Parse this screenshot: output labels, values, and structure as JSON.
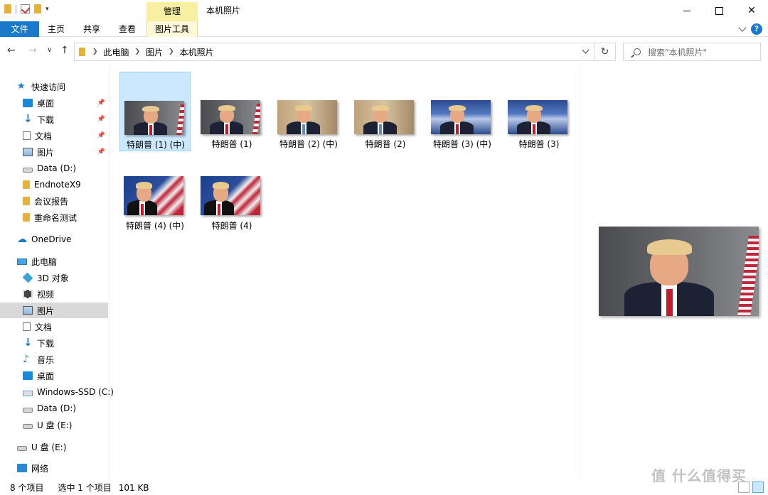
{
  "window": {
    "title": "本机照片",
    "manage_tab": "管理"
  },
  "ribbon": {
    "tabs": [
      {
        "label": "文件"
      },
      {
        "label": "主页"
      },
      {
        "label": "共享"
      },
      {
        "label": "查看"
      },
      {
        "label": "图片工具"
      }
    ]
  },
  "address": {
    "crumbs": [
      "此电脑",
      "图片",
      "本机照片"
    ],
    "search_placeholder": "搜索\"本机照片\""
  },
  "nav": {
    "quick_access": "快速访问",
    "quick_items": [
      {
        "label": "桌面",
        "icon": "desktop-icon",
        "pinned": true
      },
      {
        "label": "下载",
        "icon": "download-icon",
        "pinned": true
      },
      {
        "label": "文档",
        "icon": "document-icon",
        "pinned": true
      },
      {
        "label": "图片",
        "icon": "pictures-icon",
        "pinned": true
      },
      {
        "label": "Data (D:)",
        "icon": "drive-icon",
        "pinned": false
      },
      {
        "label": "EndnoteX9",
        "icon": "folder-icon",
        "pinned": false
      },
      {
        "label": "会议报告",
        "icon": "folder-icon",
        "pinned": false
      },
      {
        "label": "重命名测试",
        "icon": "folder-icon",
        "pinned": false
      }
    ],
    "onedrive": "OneDrive",
    "this_pc": "此电脑",
    "pc_items": [
      {
        "label": "3D 对象",
        "icon": "3d-objects-icon"
      },
      {
        "label": "视频",
        "icon": "video-icon"
      },
      {
        "label": "图片",
        "icon": "pictures-icon",
        "selected": true
      },
      {
        "label": "文档",
        "icon": "document-icon"
      },
      {
        "label": "下载",
        "icon": "download-icon"
      },
      {
        "label": "音乐",
        "icon": "music-icon"
      },
      {
        "label": "桌面",
        "icon": "desktop-icon"
      },
      {
        "label": "Windows-SSD (C:)",
        "icon": "ssd-drive-icon"
      },
      {
        "label": "Data (D:)",
        "icon": "drive-icon"
      },
      {
        "label": "U 盘 (E:)",
        "icon": "usb-drive-icon"
      }
    ],
    "usb": "U 盘 (E:)",
    "network": "网络"
  },
  "files": [
    {
      "name": "特朗普 (1) (中)",
      "selected": true
    },
    {
      "name": "特朗普 (1)",
      "selected": false
    },
    {
      "name": "特朗普 (2) (中)",
      "selected": false
    },
    {
      "name": "特朗普 (2)",
      "selected": false
    },
    {
      "name": "特朗普 (3) (中)",
      "selected": false
    },
    {
      "name": "特朗普 (3)",
      "selected": false
    },
    {
      "name": "特朗普 (4) (中)",
      "selected": false
    },
    {
      "name": "特朗普 (4)",
      "selected": false
    }
  ],
  "status": {
    "count": "8 个项目",
    "selection": "选中 1 个项目",
    "size": "101 KB"
  },
  "watermark": "值 什么值得买"
}
